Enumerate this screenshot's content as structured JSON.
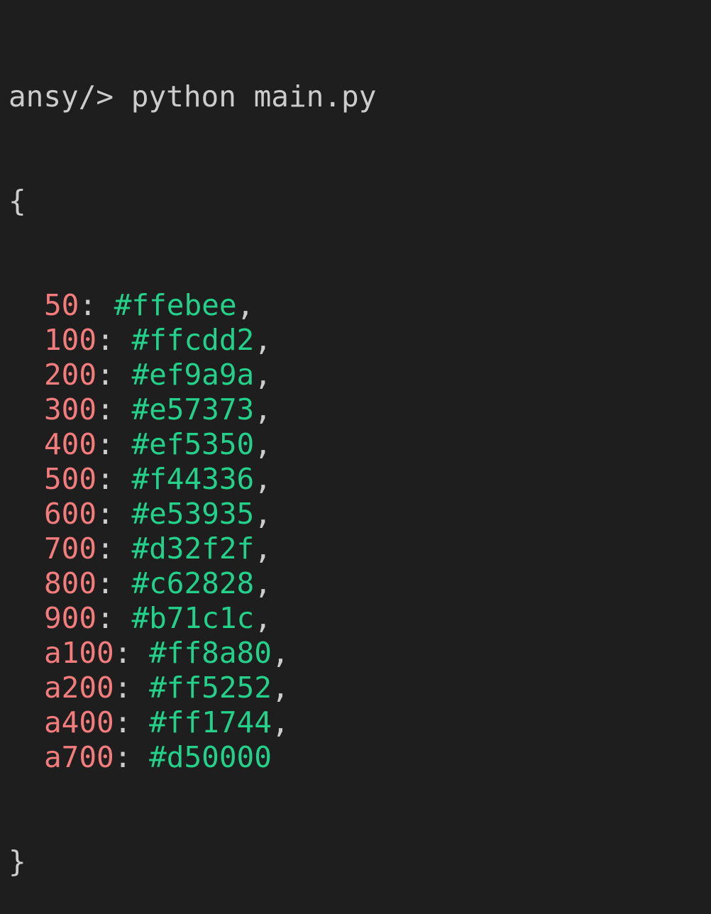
{
  "colors": {
    "background": "#1e1e1e",
    "default_text": "#cccccc",
    "key": "#f47c7c",
    "value": "#23d18b"
  },
  "terminal": {
    "prompt": "ansy/>",
    "command": "python main.py",
    "open_brace": "{",
    "close_brace": "}",
    "entries": [
      {
        "key": "50",
        "value": "#ffebee",
        "trail": ","
      },
      {
        "key": "100",
        "value": "#ffcdd2",
        "trail": ","
      },
      {
        "key": "200",
        "value": "#ef9a9a",
        "trail": ","
      },
      {
        "key": "300",
        "value": "#e57373",
        "trail": ","
      },
      {
        "key": "400",
        "value": "#ef5350",
        "trail": ","
      },
      {
        "key": "500",
        "value": "#f44336",
        "trail": ","
      },
      {
        "key": "600",
        "value": "#e53935",
        "trail": ","
      },
      {
        "key": "700",
        "value": "#d32f2f",
        "trail": ","
      },
      {
        "key": "800",
        "value": "#c62828",
        "trail": ","
      },
      {
        "key": "900",
        "value": "#b71c1c",
        "trail": ","
      },
      {
        "key": "a100",
        "value": "#ff8a80",
        "trail": ","
      },
      {
        "key": "a200",
        "value": "#ff5252",
        "trail": ","
      },
      {
        "key": "a400",
        "value": "#ff1744",
        "trail": ","
      },
      {
        "key": "a700",
        "value": "#d50000",
        "trail": ""
      }
    ]
  }
}
